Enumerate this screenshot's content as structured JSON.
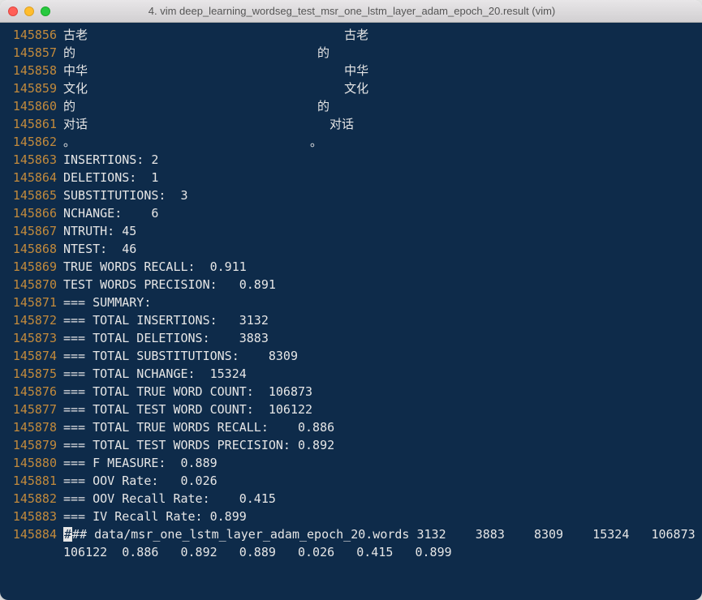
{
  "window": {
    "title": "4. vim deep_learning_wordseg_test_msr_one_lstm_layer_adam_epoch_20.result (vim)"
  },
  "colors": {
    "bg_terminal": "#0e2b4a",
    "fg_text": "#e6e6e6",
    "fg_lineno": "#c28a3c",
    "titlebar_gradient_top": "#e8e6e8",
    "titlebar_gradient_bottom": "#d2d0d2"
  },
  "lines": [
    {
      "num": "145856",
      "text": "古老                                   古老"
    },
    {
      "num": "145857",
      "text": "的                                 的"
    },
    {
      "num": "145858",
      "text": "中华                                   中华"
    },
    {
      "num": "145859",
      "text": "文化                                   文化"
    },
    {
      "num": "145860",
      "text": "的                                 的"
    },
    {
      "num": "145861",
      "text": "对话                                 对话"
    },
    {
      "num": "145862",
      "text": "。                                。"
    },
    {
      "num": "145863",
      "text": "INSERTIONS: 2"
    },
    {
      "num": "145864",
      "text": "DELETIONS:  1"
    },
    {
      "num": "145865",
      "text": "SUBSTITUTIONS:  3"
    },
    {
      "num": "145866",
      "text": "NCHANGE:    6"
    },
    {
      "num": "145867",
      "text": "NTRUTH: 45"
    },
    {
      "num": "145868",
      "text": "NTEST:  46"
    },
    {
      "num": "145869",
      "text": "TRUE WORDS RECALL:  0.911"
    },
    {
      "num": "145870",
      "text": "TEST WORDS PRECISION:   0.891"
    },
    {
      "num": "145871",
      "text": "=== SUMMARY:"
    },
    {
      "num": "145872",
      "text": "=== TOTAL INSERTIONS:   3132"
    },
    {
      "num": "145873",
      "text": "=== TOTAL DELETIONS:    3883"
    },
    {
      "num": "145874",
      "text": "=== TOTAL SUBSTITUTIONS:    8309"
    },
    {
      "num": "145875",
      "text": "=== TOTAL NCHANGE:  15324"
    },
    {
      "num": "145876",
      "text": "=== TOTAL TRUE WORD COUNT:  106873"
    },
    {
      "num": "145877",
      "text": "=== TOTAL TEST WORD COUNT:  106122"
    },
    {
      "num": "145878",
      "text": "=== TOTAL TRUE WORDS RECALL:    0.886"
    },
    {
      "num": "145879",
      "text": "=== TOTAL TEST WORDS PRECISION: 0.892"
    },
    {
      "num": "145880",
      "text": "=== F MEASURE:  0.889"
    },
    {
      "num": "145881",
      "text": "=== OOV Rate:   0.026"
    },
    {
      "num": "145882",
      "text": "=== OOV Recall Rate:    0.415"
    },
    {
      "num": "145883",
      "text": "=== IV Recall Rate: 0.899"
    },
    {
      "num": "145884",
      "text": "## data/msr_one_lstm_layer_adam_epoch_20.words 3132    3883    8309    15324   106873  106122  0.886   0.892   0.889   0.026   0.415   0.899",
      "cursor": "#"
    }
  ]
}
